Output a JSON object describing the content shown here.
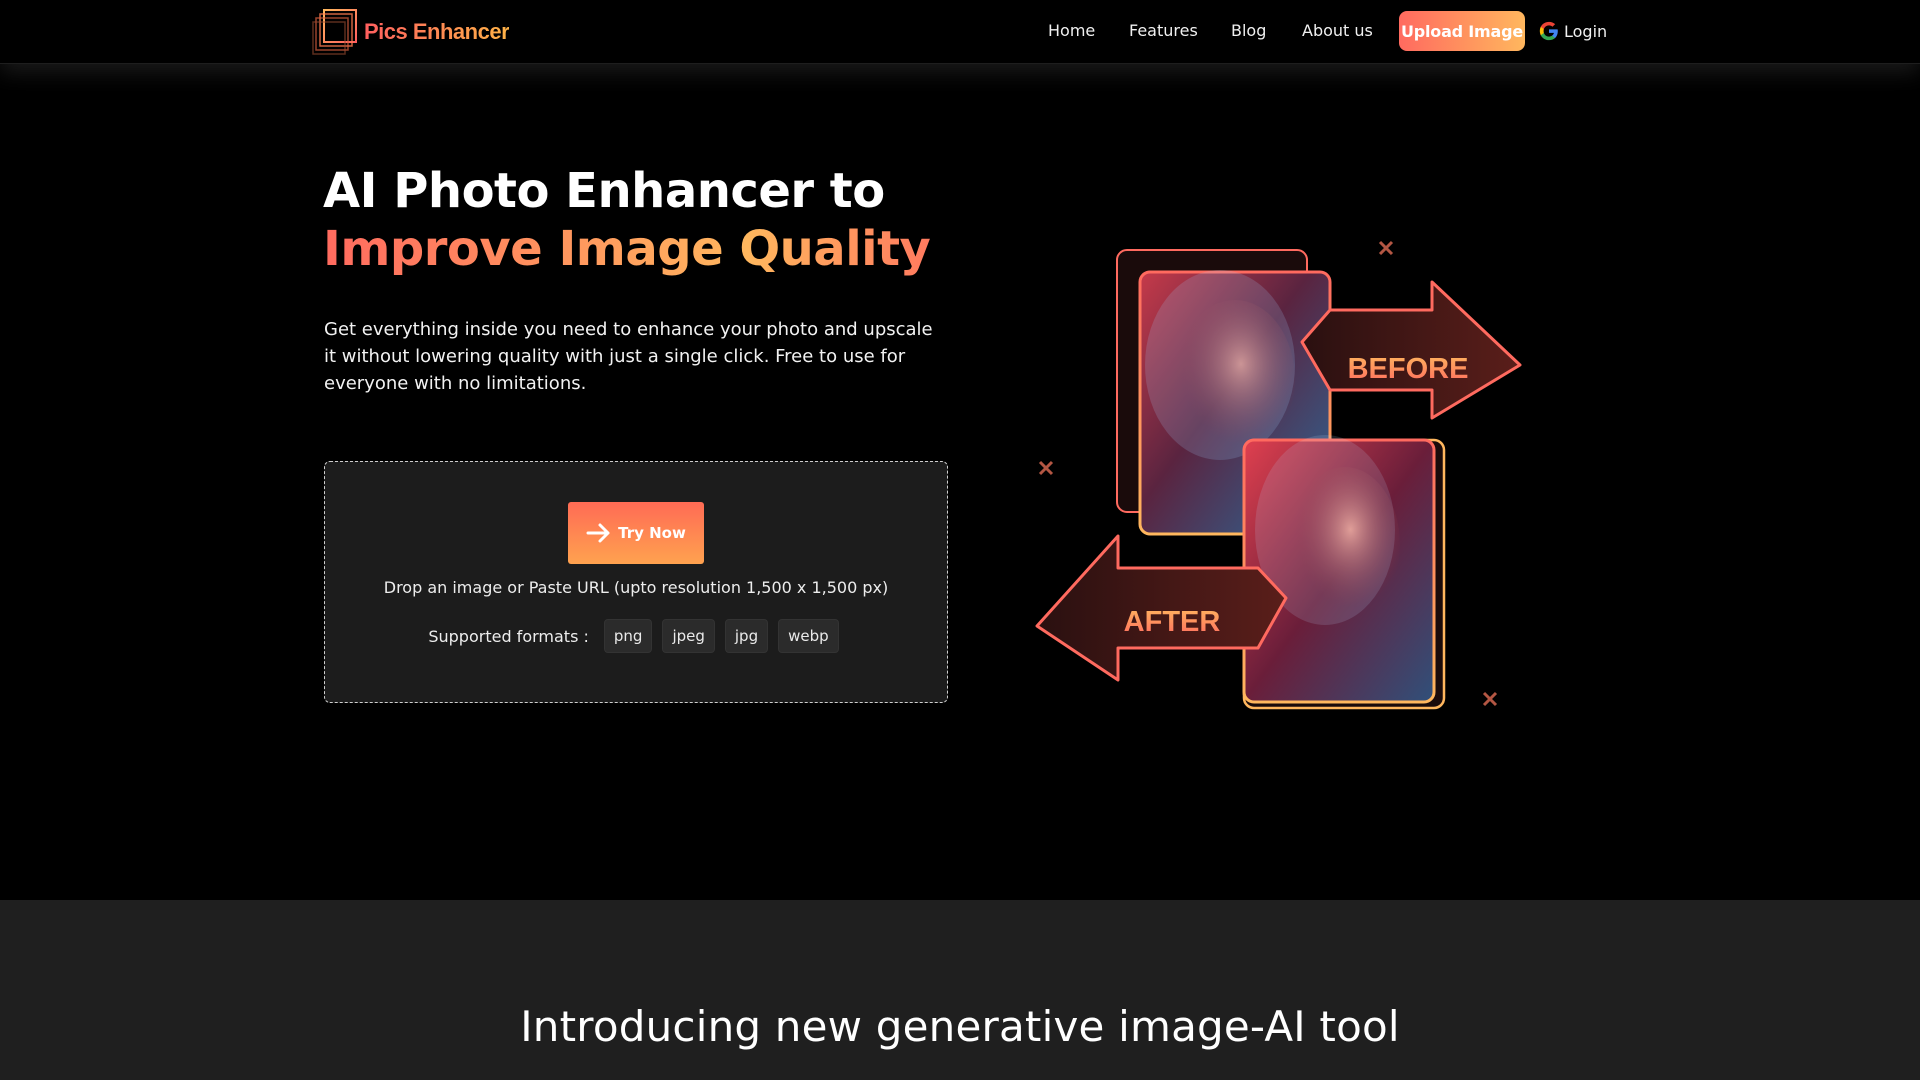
{
  "brand": {
    "name": "Pics Enhancer"
  },
  "nav": {
    "links": [
      "Home",
      "Features",
      "Blog",
      "About us"
    ],
    "upload_label": "Upload Image",
    "login_label": "Login"
  },
  "hero": {
    "title_line1": "AI Photo Enhancer to",
    "title_line2": "Improve Image Quality",
    "description": "Get everything inside you need to enhance your photo and upscale it without lowering quality with just a single click. Free to use for everyone with no limitations."
  },
  "upload_box": {
    "button_label": "Try Now",
    "hint": "Drop an image or Paste URL (upto resolution 1,500 x 1,500 px)",
    "formats_label": "Supported formats :",
    "formats": [
      "png",
      "jpeg",
      "jpg",
      "webp"
    ]
  },
  "illustration": {
    "before_label": "BEFORE",
    "after_label": "AFTER"
  },
  "section2": {
    "heading": "Introducing new generative image-AI tool"
  },
  "colors": {
    "accent_start": "#ff6a5f",
    "accent_end": "#ffb75e",
    "background": "#000000",
    "panel": "#1c1c1c"
  }
}
